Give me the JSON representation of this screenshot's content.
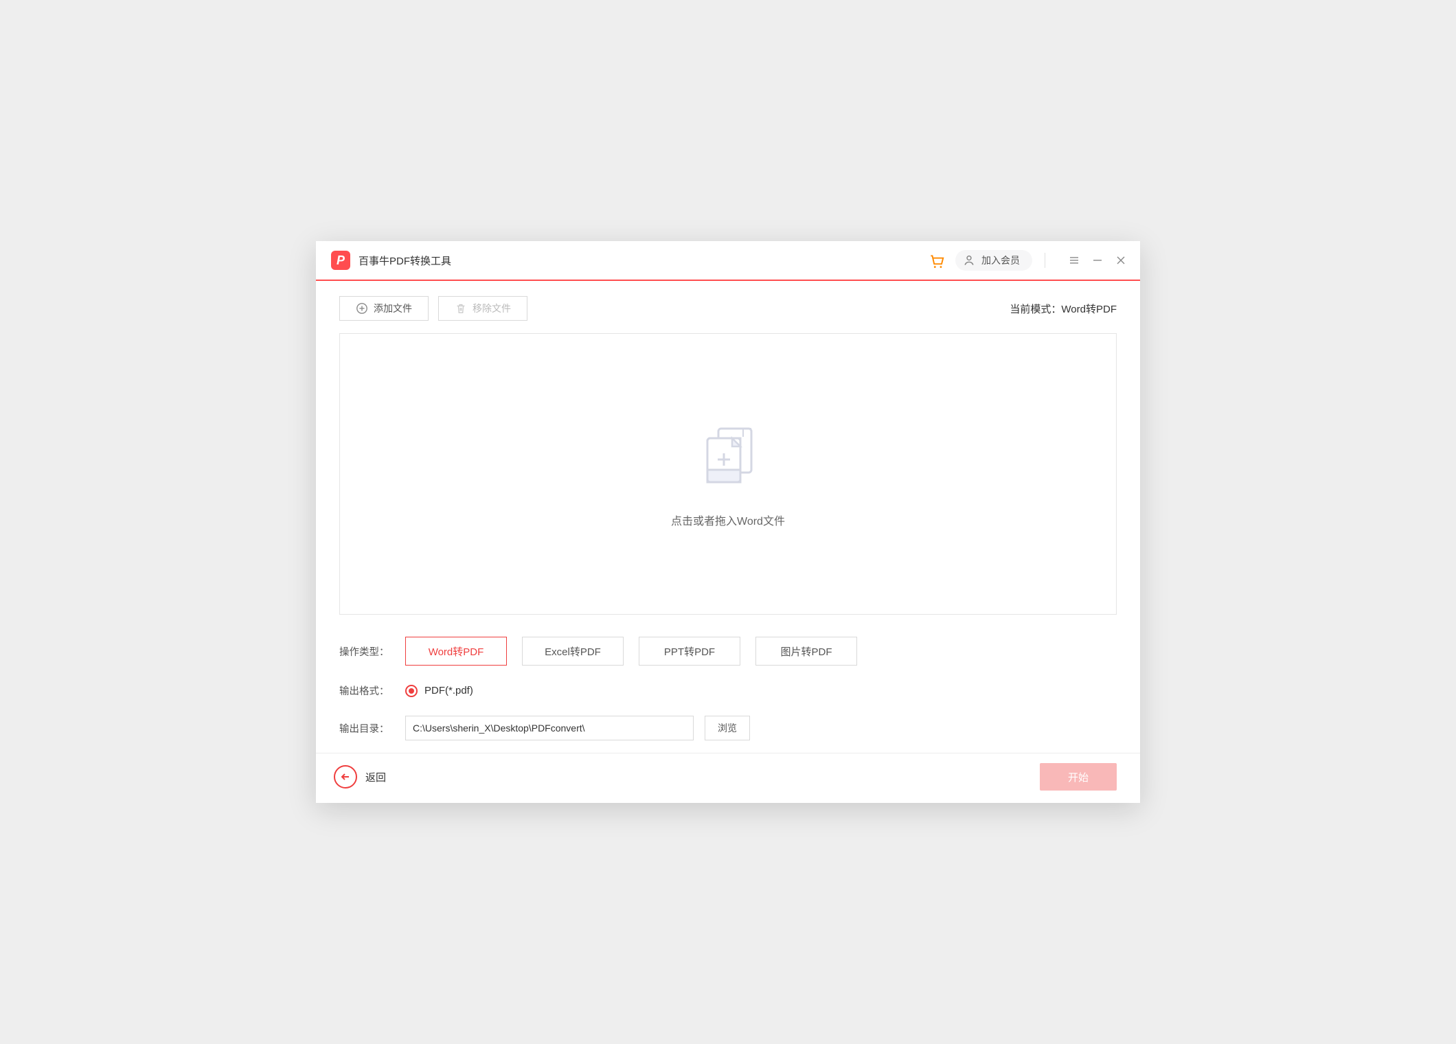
{
  "titlebar": {
    "app_title": "百事牛PDF转换工具",
    "member_label": "加入会员"
  },
  "toolbar": {
    "add_file": "添加文件",
    "remove_file": "移除文件",
    "mode_prefix": "当前模式：",
    "mode_value": "Word转PDF"
  },
  "dropzone": {
    "hint": "点击或者拖入Word文件"
  },
  "options": {
    "type_label": "操作类型：",
    "types": {
      "word": "Word转PDF",
      "excel": "Excel转PDF",
      "ppt": "PPT转PDF",
      "image": "图片转PDF"
    },
    "format_label": "输出格式：",
    "format_value": "PDF(*.pdf)",
    "dir_label": "输出目录：",
    "dir_value": "C:\\Users\\sherin_X\\Desktop\\PDFconvert\\",
    "browse": "浏览"
  },
  "footer": {
    "back": "返回",
    "start": "开始"
  }
}
